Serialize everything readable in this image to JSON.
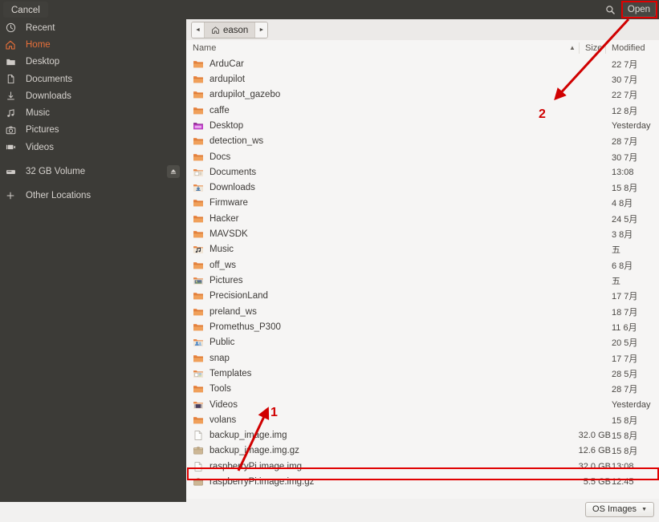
{
  "header": {
    "cancel_label": "Cancel",
    "search_icon": "search-icon",
    "open_label": "Open"
  },
  "sidebar": {
    "items": [
      {
        "label": "Recent",
        "icon": "clock-icon",
        "selected": false
      },
      {
        "label": "Home",
        "icon": "home-icon",
        "selected": true
      },
      {
        "label": "Desktop",
        "icon": "folder-icon",
        "selected": false
      },
      {
        "label": "Documents",
        "icon": "document-icon",
        "selected": false
      },
      {
        "label": "Downloads",
        "icon": "download-icon",
        "selected": false
      },
      {
        "label": "Music",
        "icon": "music-note-icon",
        "selected": false
      },
      {
        "label": "Pictures",
        "icon": "camera-icon",
        "selected": false
      },
      {
        "label": "Videos",
        "icon": "video-icon",
        "selected": false
      }
    ],
    "volumes": [
      {
        "label": "32 GB Volume",
        "icon": "drive-icon",
        "eject_icon": "eject-icon"
      }
    ],
    "other": {
      "label": "Other Locations",
      "icon": "plus-icon"
    }
  },
  "pathbar": {
    "back_icon": "chevron-left-icon",
    "forward_icon": "chevron-right-icon",
    "crumb_icon": "home-icon",
    "crumb_label": "eason"
  },
  "columns": {
    "name": "Name",
    "size": "Size",
    "modified": "Modified",
    "sort_icon": "sort-ascending-icon"
  },
  "files": [
    {
      "name": "ArduCar",
      "icon": "folder-icon",
      "size": "",
      "modified": "22 7月"
    },
    {
      "name": "ardupilot",
      "icon": "folder-icon",
      "size": "",
      "modified": "30 7月"
    },
    {
      "name": "ardupilot_gazebo",
      "icon": "folder-icon",
      "size": "",
      "modified": "22 7月"
    },
    {
      "name": "caffe",
      "icon": "folder-icon",
      "size": "",
      "modified": "12 8月"
    },
    {
      "name": "Desktop",
      "icon": "desktop-folder-icon",
      "size": "",
      "modified": "Yesterday"
    },
    {
      "name": "detection_ws",
      "icon": "folder-icon",
      "size": "",
      "modified": "28 7月"
    },
    {
      "name": "Docs",
      "icon": "folder-icon",
      "size": "",
      "modified": "30 7月"
    },
    {
      "name": "Documents",
      "icon": "documents-folder-icon",
      "size": "",
      "modified": "13:08"
    },
    {
      "name": "Downloads",
      "icon": "downloads-folder-icon",
      "size": "",
      "modified": "15 8月"
    },
    {
      "name": "Firmware",
      "icon": "folder-icon",
      "size": "",
      "modified": "4 8月"
    },
    {
      "name": "Hacker",
      "icon": "folder-icon",
      "size": "",
      "modified": "24 5月"
    },
    {
      "name": "MAVSDK",
      "icon": "folder-icon",
      "size": "",
      "modified": "3 8月"
    },
    {
      "name": "Music",
      "icon": "music-folder-icon",
      "size": "",
      "modified": "五"
    },
    {
      "name": "off_ws",
      "icon": "folder-icon",
      "size": "",
      "modified": "6 8月"
    },
    {
      "name": "Pictures",
      "icon": "pictures-folder-icon",
      "size": "",
      "modified": "五"
    },
    {
      "name": "PrecisionLand",
      "icon": "folder-icon",
      "size": "",
      "modified": "17 7月"
    },
    {
      "name": "preland_ws",
      "icon": "folder-icon",
      "size": "",
      "modified": "18 7月"
    },
    {
      "name": "Promethus_P300",
      "icon": "folder-icon",
      "size": "",
      "modified": "11 6月"
    },
    {
      "name": "Public",
      "icon": "public-folder-icon",
      "size": "",
      "modified": "20 5月"
    },
    {
      "name": "snap",
      "icon": "folder-icon",
      "size": "",
      "modified": "17 7月"
    },
    {
      "name": "Templates",
      "icon": "templates-folder-icon",
      "size": "",
      "modified": "28 5月"
    },
    {
      "name": "Tools",
      "icon": "folder-icon",
      "size": "",
      "modified": "28 7月"
    },
    {
      "name": "Videos",
      "icon": "videos-folder-icon",
      "size": "",
      "modified": "Yesterday"
    },
    {
      "name": "volans",
      "icon": "folder-icon",
      "size": "",
      "modified": "15 8月"
    },
    {
      "name": "backup_image.img",
      "icon": "file-icon",
      "size": "32.0 GB",
      "modified": "15 8月"
    },
    {
      "name": "backup_image.img.gz",
      "icon": "archive-icon",
      "size": "12.6 GB",
      "modified": "15 8月"
    },
    {
      "name": "raspberryPi.image.img",
      "icon": "file-icon",
      "size": "32.0 GB",
      "modified": "13:08"
    },
    {
      "name": "raspberryPi.image.img.gz",
      "icon": "archive-icon",
      "size": "5.5 GB",
      "modified": "12:45"
    }
  ],
  "filter": {
    "label": "OS Images",
    "caret_icon": "chevron-down-icon"
  },
  "annotations": {
    "step1": "1",
    "step2": "2",
    "color": "#d00000"
  },
  "colors": {
    "headerbar_bg": "#3c3b37",
    "sidebar_bg": "#3c3b37",
    "accent": "#e8703a",
    "pane_bg": "#f6f5f4",
    "annotation_red": "#d00000"
  }
}
